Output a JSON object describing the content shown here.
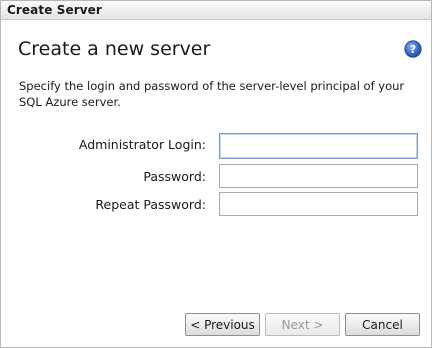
{
  "window": {
    "title": "Create Server"
  },
  "page": {
    "heading": "Create a new server",
    "help_icon": "help-question-icon",
    "description": "Specify the login and password of the server-level principal of your SQL Azure server."
  },
  "form": {
    "fields": [
      {
        "label": "Administrator Login:",
        "value": "",
        "focused": true
      },
      {
        "label": "Password:",
        "value": ""
      },
      {
        "label": "Repeat Password:",
        "value": ""
      }
    ]
  },
  "buttons": {
    "previous": "< Previous",
    "next": "Next >",
    "next_disabled": true,
    "cancel": "Cancel"
  },
  "colors": {
    "help_icon_blue": "#2f5fb4",
    "titlebar_gradient_top": "#fbfbfb",
    "titlebar_gradient_bottom": "#e4e4e4"
  }
}
